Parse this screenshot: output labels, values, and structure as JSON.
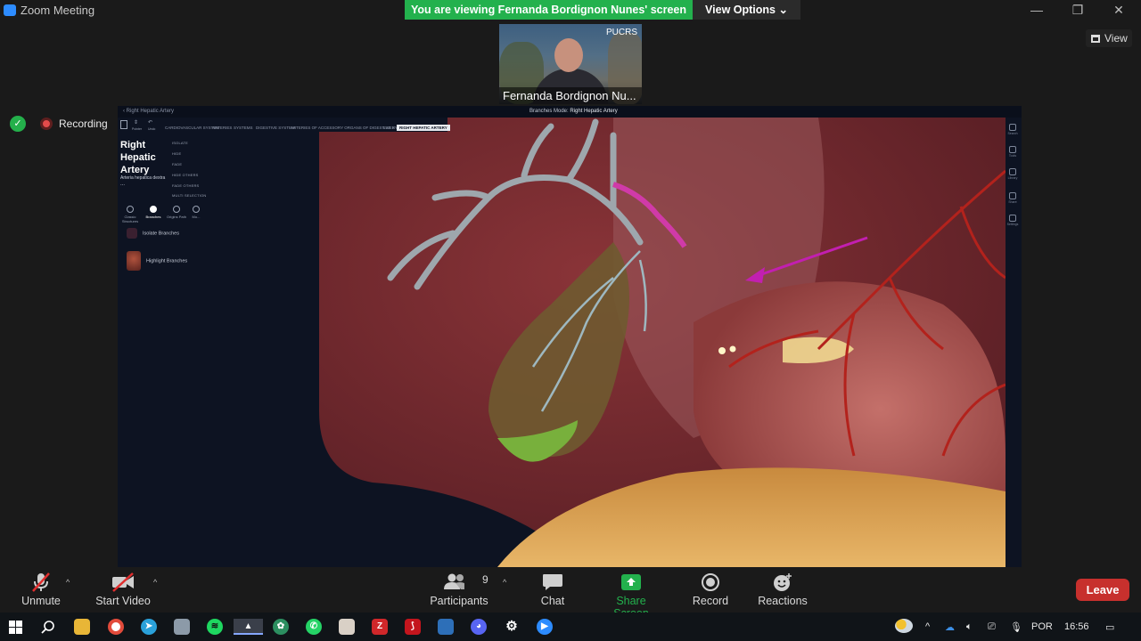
{
  "window": {
    "title": "Zoom Meeting"
  },
  "banner": {
    "text": "You are viewing Fernanda Bordignon Nunes' screen",
    "view_options": "View Options"
  },
  "video": {
    "org_label": "PUCRS",
    "participant_name": "Fernanda Bordignon Nu..."
  },
  "view_button": {
    "label": "View"
  },
  "recording": {
    "label": "Recording"
  },
  "shared_screen": {
    "breadcrumb": "Right Hepatic Artery",
    "mode_label": "Branches Mode:",
    "mode_value": "Right Hepatic Artery",
    "nav_tabs": [
      "CARDIOVASCULAR SYSTEM",
      "ARTERIES",
      "SYSTEMS",
      "DIGESTIVE SYSTEM",
      "ARTERIES OF ACCESSORY ORGANS OF DIGESTIVE SYSTEM",
      "LIVER",
      "RIGHT HEPATIC ARTERY"
    ],
    "structure_title": "Right Hepatic Artery",
    "structure_latin": "Arteria hepatica dextra",
    "structure_more": "...",
    "options": [
      "ISOLATE",
      "HIDE",
      "FADE",
      "HIDE OTHERS",
      "FADE OTHERS",
      "MULTI SELECTION"
    ],
    "top_tools": [
      "Pointer",
      "Undo"
    ],
    "modes": [
      "Classic Structures",
      "Branches",
      "Origins Path",
      "Mo..."
    ],
    "actions": [
      "Isolate Branches",
      "Highlight Branches"
    ],
    "side_tools": [
      "Search",
      "Tools",
      "Library",
      "Share",
      "Settings"
    ]
  },
  "toolbar": {
    "unmute": "Unmute",
    "start_video": "Start Video",
    "participants": "Participants",
    "participants_count": "9",
    "chat": "Chat",
    "share_screen": "Share Screen",
    "record": "Record",
    "reactions": "Reactions",
    "leave": "Leave"
  },
  "taskbar": {
    "language": "POR",
    "time": "16:56"
  },
  "colors": {
    "zoom_green": "#23b14d",
    "leave_red": "#c7302d",
    "zoom_blue": "#2d8cff",
    "annotation_arrow": "#c21fb0"
  }
}
